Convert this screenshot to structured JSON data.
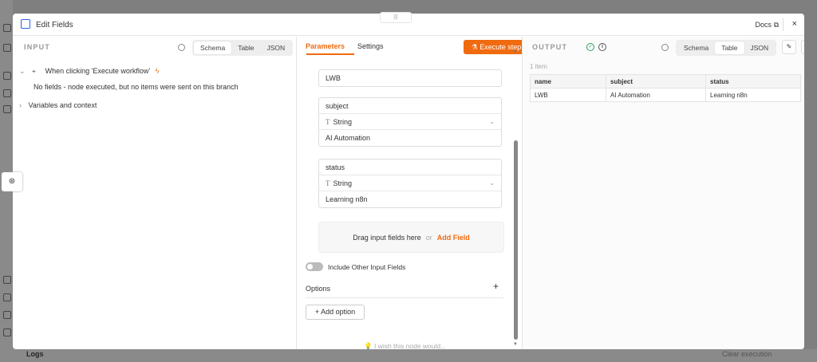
{
  "modal": {
    "title": "Edit Fields",
    "docs_label": "Docs",
    "close_label": "×"
  },
  "input_panel": {
    "label": "INPUT",
    "view_tabs": [
      "Schema",
      "Table",
      "JSON"
    ],
    "selected_view": "Schema",
    "trigger_label": "When clicking 'Execute workflow'",
    "no_fields_message": "No fields - node executed, but no items were sent on this branch",
    "variables_label": "Variables and context"
  },
  "params_panel": {
    "tabs": [
      "Parameters",
      "Settings"
    ],
    "active_tab": "Parameters",
    "execute_label": "Execute step",
    "fields": [
      {
        "name": "LWB"
      },
      {
        "name": "subject",
        "type": "String",
        "value": "AI Automation"
      },
      {
        "name": "status",
        "type": "String",
        "value": "Learning n8n"
      }
    ],
    "drop_text": "Drag input fields here",
    "drop_or": "or",
    "add_field": "Add Field",
    "include_other_label": "Include Other Input Fields",
    "options_label": "Options",
    "add_option_label": "+ Add option",
    "wish_label": "I wish this node would..."
  },
  "output_panel": {
    "label": "OUTPUT",
    "view_tabs": [
      "Schema",
      "Table",
      "JSON"
    ],
    "selected_view": "Table",
    "item_count": "1 item",
    "columns": [
      "name",
      "subject",
      "status"
    ],
    "rows": [
      [
        "LWB",
        "AI Automation",
        "Learning n8n"
      ]
    ]
  },
  "footer": {
    "logs_label": "Logs",
    "clear_label": "Clear execution"
  }
}
